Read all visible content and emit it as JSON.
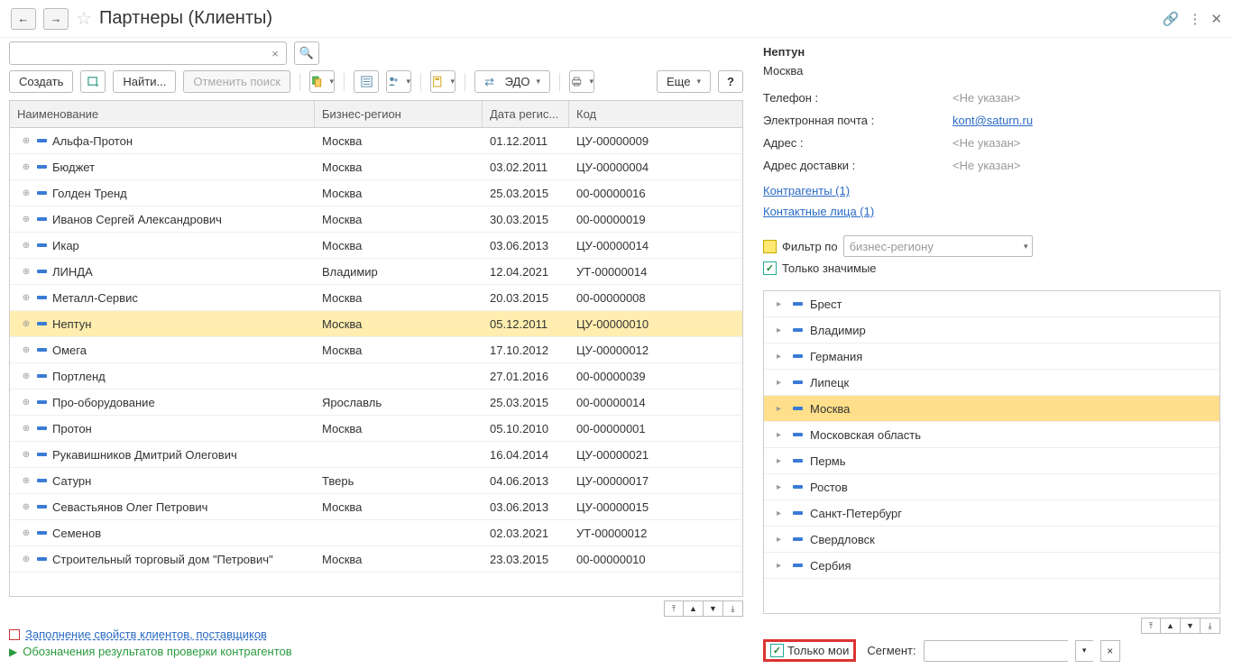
{
  "header": {
    "title": "Партнеры (Клиенты)"
  },
  "toolbar": {
    "create": "Создать",
    "find": "Найти...",
    "cancel_search": "Отменить поиск",
    "edo": "ЭДО",
    "more": "Еще"
  },
  "columns": {
    "name": "Наименование",
    "region": "Бизнес-регион",
    "date": "Дата регис...",
    "code": "Код"
  },
  "rows": [
    {
      "name": "Альфа-Протон",
      "region": "Москва",
      "date": "01.12.2011",
      "code": "ЦУ-00000009",
      "sel": false
    },
    {
      "name": "Бюджет",
      "region": "Москва",
      "date": "03.02.2011",
      "code": "ЦУ-00000004",
      "sel": false
    },
    {
      "name": "Голден Тренд",
      "region": "Москва",
      "date": "25.03.2015",
      "code": "00-00000016",
      "sel": false
    },
    {
      "name": "Иванов Сергей Александрович",
      "region": "Москва",
      "date": "30.03.2015",
      "code": "00-00000019",
      "sel": false
    },
    {
      "name": "Икар",
      "region": "Москва",
      "date": "03.06.2013",
      "code": "ЦУ-00000014",
      "sel": false
    },
    {
      "name": "ЛИНДА",
      "region": "Владимир",
      "date": "12.04.2021",
      "code": "УТ-00000014",
      "sel": false
    },
    {
      "name": "Металл-Сервис",
      "region": "Москва",
      "date": "20.03.2015",
      "code": "00-00000008",
      "sel": false
    },
    {
      "name": "Нептун",
      "region": "Москва",
      "date": "05.12.2011",
      "code": "ЦУ-00000010",
      "sel": true
    },
    {
      "name": "Омега",
      "region": "Москва",
      "date": "17.10.2012",
      "code": "ЦУ-00000012",
      "sel": false
    },
    {
      "name": "Портленд",
      "region": "",
      "date": "27.01.2016",
      "code": "00-00000039",
      "sel": false
    },
    {
      "name": "Про-оборудование",
      "region": "Ярославль",
      "date": "25.03.2015",
      "code": "00-00000014",
      "sel": false
    },
    {
      "name": "Протон",
      "region": "Москва",
      "date": "05.10.2010",
      "code": "00-00000001",
      "sel": false
    },
    {
      "name": "Рукавишников Дмитрий Олегович",
      "region": "",
      "date": "16.04.2014",
      "code": "ЦУ-00000021",
      "sel": false
    },
    {
      "name": "Сатурн",
      "region": "Тверь",
      "date": "04.06.2013",
      "code": "ЦУ-00000017",
      "sel": false
    },
    {
      "name": "Севастьянов Олег Петрович",
      "region": "Москва",
      "date": "03.06.2013",
      "code": "ЦУ-00000015",
      "sel": false
    },
    {
      "name": "Семенов",
      "region": "",
      "date": "02.03.2021",
      "code": "УТ-00000012",
      "sel": false
    },
    {
      "name": "Строительный торговый дом \"Петрович\"",
      "region": "Москва",
      "date": "23.03.2015",
      "code": "00-00000010",
      "sel": false
    }
  ],
  "links": {
    "fill_props": "Заполнение свойств клиентов, поставщиков",
    "check_results": "Обозначения результатов проверки контрагентов"
  },
  "details": {
    "title": "Нептун",
    "city": "Москва",
    "phone_label": "Телефон :",
    "phone_val": "<Не указан>",
    "email_label": "Электронная почта :",
    "email_val": "kont@saturn.ru",
    "address_label": "Адрес :",
    "address_val": "<Не указан>",
    "delivery_label": "Адрес доставки :",
    "delivery_val": "<Не указан>",
    "contragents": "Контрагенты (1)",
    "contacts": "Контактные лица (1)"
  },
  "filter": {
    "by_label": "Фильтр по",
    "by_placeholder": "бизнес-региону",
    "only_significant": "Только значимые"
  },
  "regions": [
    {
      "name": "Брест",
      "sel": false
    },
    {
      "name": "Владимир",
      "sel": false
    },
    {
      "name": "Германия",
      "sel": false
    },
    {
      "name": "Липецк",
      "sel": false
    },
    {
      "name": "Москва",
      "sel": true
    },
    {
      "name": "Московская область",
      "sel": false
    },
    {
      "name": "Пермь",
      "sel": false
    },
    {
      "name": "Ростов",
      "sel": false
    },
    {
      "name": "Санкт-Петербург",
      "sel": false
    },
    {
      "name": "Свердловск",
      "sel": false
    },
    {
      "name": "Сербия",
      "sel": false
    }
  ],
  "bottom": {
    "only_mine": "Только мои",
    "segment_label": "Сегмент:"
  }
}
